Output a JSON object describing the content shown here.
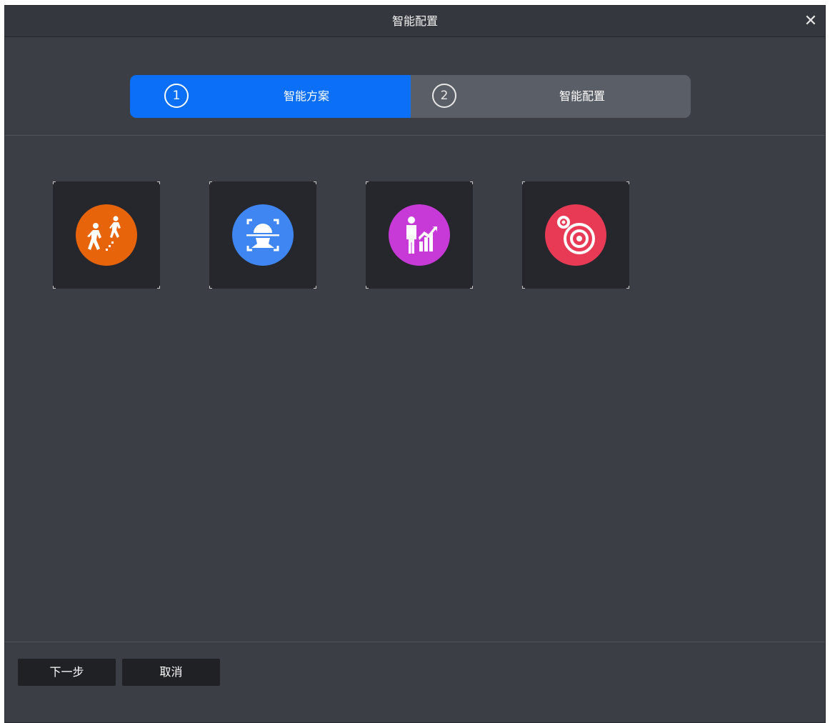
{
  "window": {
    "title": "智能配置",
    "close_icon": "close-icon"
  },
  "stepper": {
    "steps": [
      {
        "number": "1",
        "label": "智能方案",
        "state": "active"
      },
      {
        "number": "2",
        "label": "智能配置",
        "state": "inactive"
      }
    ],
    "active_color": "#0b6ff7",
    "inactive_color": "#5a5e66"
  },
  "scenarios": [
    {
      "icon": "people-counting-icon",
      "color": "#e8640a"
    },
    {
      "icon": "face-detection-icon",
      "color": "#3f86f2"
    },
    {
      "icon": "people-analytics-icon",
      "color": "#c73ad8"
    },
    {
      "icon": "target-detection-icon",
      "color": "#e83a55"
    }
  ],
  "footer": {
    "next_label": "下一步",
    "cancel_label": "取消"
  }
}
